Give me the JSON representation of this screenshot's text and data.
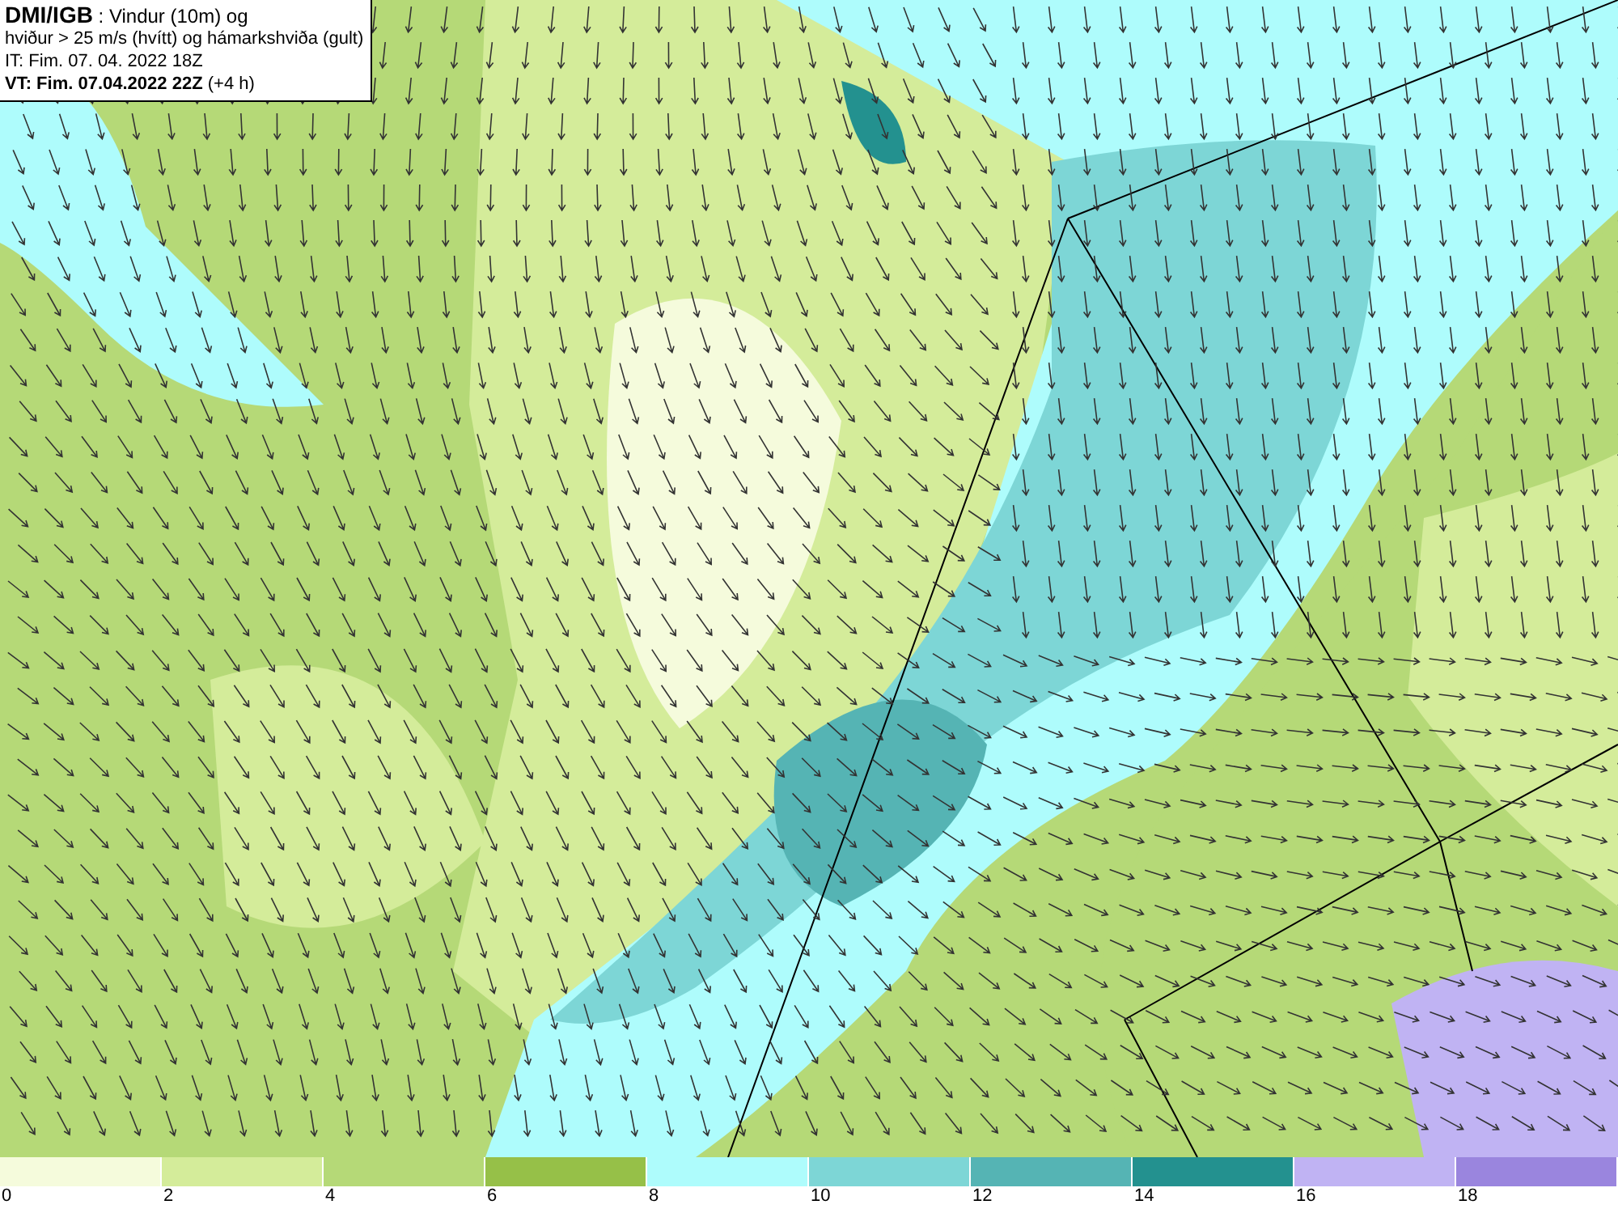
{
  "info_box": {
    "lines": [
      "**DMI/IGB** : Vindur (10m) og",
      "hviður > 25 m/s (hvítt) og hámarkshviða (gult)",
      "IT: Fim. 07. 04. 2022 18Z",
      "**VT: Fim. 07.04.2022 22Z** (+4 h)"
    ]
  },
  "legend": [
    {
      "label": "0",
      "color": "#f5fbdc"
    },
    {
      "label": "2",
      "color": "#d4ec9a"
    },
    {
      "label": "4",
      "color": "#b5d977"
    },
    {
      "label": "6",
      "color": "#96c048"
    },
    {
      "label": "8",
      "color": "#aefcfc"
    },
    {
      "label": "10",
      "color": "#7dd6d6"
    },
    {
      "label": "12",
      "color": "#55b4b4"
    },
    {
      "label": "14",
      "color": "#23918f"
    },
    {
      "label": "16",
      "color": "#c0b3f3"
    },
    {
      "label": "18",
      "color": "#9a85de"
    }
  ]
}
